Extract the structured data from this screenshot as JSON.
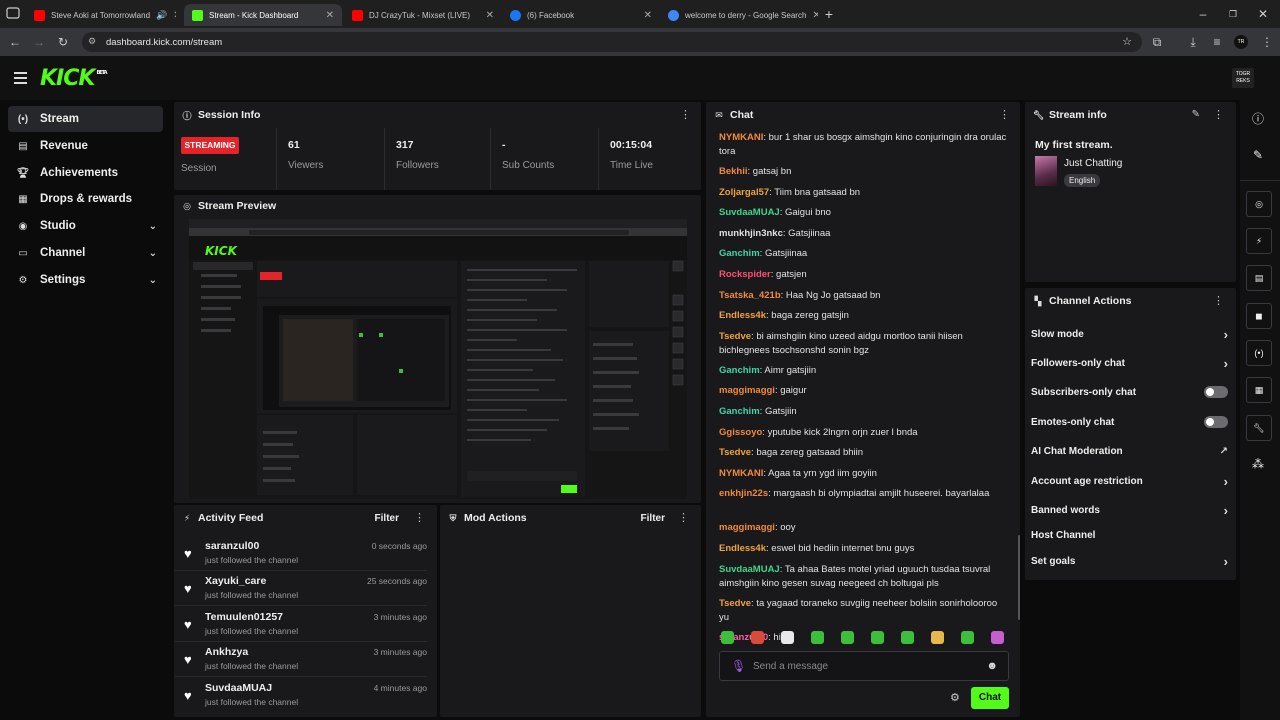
{
  "browser": {
    "tabs": [
      {
        "title": "Steve Aoki at Tomorrowland",
        "favicon_color": "#ff0000"
      },
      {
        "title": "Stream - Kick Dashboard",
        "favicon_color": "#53fc18"
      },
      {
        "title": "DJ CrazyTuk - Mixset (LIVE)",
        "favicon_color": "#ff0000"
      },
      {
        "title": "(6) Facebook",
        "favicon_color": "#1877f2"
      },
      {
        "title": "welcome to derry - Google Search",
        "favicon_color": "#4285f4"
      }
    ],
    "url": "dashboard.kick.com/stream"
  },
  "app": {
    "logo": "KICK",
    "logo_badge": "BETA",
    "avatar_text": "TOGR REKS"
  },
  "sidebar": {
    "items": [
      {
        "label": "Stream",
        "icon": "broadcast-icon"
      },
      {
        "label": "Revenue",
        "icon": "revenue-icon"
      },
      {
        "label": "Achievements",
        "icon": "trophy-icon"
      },
      {
        "label": "Drops & rewards",
        "icon": "gift-icon"
      },
      {
        "label": "Studio",
        "icon": "studio-icon"
      },
      {
        "label": "Channel",
        "icon": "channel-icon"
      },
      {
        "label": "Settings",
        "icon": "gear-icon"
      }
    ]
  },
  "session": {
    "title": "Session Info",
    "badge": "STREAMING",
    "session_label": "Session",
    "viewers": "61",
    "viewers_label": "Viewers",
    "followers": "317",
    "followers_label": "Followers",
    "subs": "-",
    "subs_label": "Sub Counts",
    "time": "00:15:04",
    "time_label": "Time Live"
  },
  "preview": {
    "title": "Stream Preview"
  },
  "activity": {
    "title": "Activity Feed",
    "filter": "Filter",
    "items": [
      {
        "name": "saranzul00",
        "sub": "just followed the channel",
        "time": "0 seconds ago"
      },
      {
        "name": "Xayuki_care",
        "sub": "just followed the channel",
        "time": "25 seconds ago"
      },
      {
        "name": "Temuulen01257",
        "sub": "just followed the channel",
        "time": "3 minutes ago"
      },
      {
        "name": "Ankhzya",
        "sub": "just followed the channel",
        "time": "3 minutes ago"
      },
      {
        "name": "SuvdaaMUAJ",
        "sub": "just followed the channel",
        "time": "4 minutes ago"
      }
    ]
  },
  "mod": {
    "title": "Mod Actions",
    "filter": "Filter"
  },
  "chat": {
    "title": "Chat",
    "messages": [
      {
        "user": "NYMKANI",
        "color": "#f08a3c",
        "text": "bur 1 shar us bosgx aimshgin kino conjuringin dra orulac tora"
      },
      {
        "user": "Bekhii",
        "color": "#f08a3c",
        "text": "gatsaj bn"
      },
      {
        "user": "Zoljargal57",
        "color": "#f0a23c",
        "text": "Tiim bna gatsaad bn"
      },
      {
        "user": "SuvdaaMUAJ",
        "color": "#3dd68c",
        "text": "Gaigui bno"
      },
      {
        "user": "munkhjin3nkc",
        "color": "#e0e0e0",
        "text": "Gatsjiinaa"
      },
      {
        "user": "Ganchim",
        "color": "#3dd6a8",
        "text": "Gatsjiinaa"
      },
      {
        "user": "Rockspider",
        "color": "#ff4f6d",
        "text": "gatsjen"
      },
      {
        "user": "Tsatska_421b",
        "color": "#f08a3c",
        "text": "Haa Ng Jo gatsaad bn"
      },
      {
        "user": "Endless4k",
        "color": "#f0a23c",
        "text": "baga zereg gatsjin"
      },
      {
        "user": "Tsedve",
        "color": "#f0a23c",
        "text": "bi aimshgiin kino uzeed aidgu mortloo tanii hiisen bichlegnees tsochsonshd sonin bgz"
      },
      {
        "user": "Ganchim",
        "color": "#3dd6a8",
        "text": "Aimr gatsjiin"
      },
      {
        "user": "maggimaggi",
        "color": "#f08a3c",
        "text": "gaigur"
      },
      {
        "user": "Ganchim",
        "color": "#3dd6a8",
        "text": "Gatsjiin"
      },
      {
        "user": "Ggissoyo",
        "color": "#f08a3c",
        "text": "yputube kick 2lngrn orjn zuer l bnda"
      },
      {
        "user": "Tsedve",
        "color": "#f0a23c",
        "text": "baga zereg gatsaad bhiin"
      },
      {
        "user": "NYMKANI",
        "color": "#f08a3c",
        "text": "Agaa ta yrn ygd iim goyiin"
      },
      {
        "user": "enkhjin22s",
        "color": "#f08a3c",
        "text": "margaash bi olympiadtai amjilt huseerei. bayarlalaa"
      },
      {
        "user": "maggimaggi",
        "color": "#f08a3c",
        "text": "ooy"
      },
      {
        "user": "Endless4k",
        "color": "#f0a23c",
        "text": "eswel bid hediin internet bnu guys"
      },
      {
        "user": "SuvdaaMUAJ",
        "color": "#3dd68c",
        "text": "Ta ahaa Bates motel yriad uguuch tusdaa tsuvral aimshgiin kino gesen suvag neegeed ch boltugai pls"
      },
      {
        "user": "Tsedve",
        "color": "#f0a23c",
        "text": "ta yagaad toraneko suvgiig neeheer bolsiin sonirholooroo yu"
      },
      {
        "user": "saranzul00",
        "color": "#ff5fa8",
        "text": "hiii"
      }
    ],
    "placeholder": "Send a message",
    "send_label": "Chat"
  },
  "stream_info": {
    "title": "Stream info",
    "stream_title": "My first stream.",
    "category": "Just Chatting",
    "language": "English"
  },
  "channel_actions": {
    "title": "Channel Actions",
    "items": [
      {
        "label": "Slow mode",
        "control": "chevron"
      },
      {
        "label": "Followers-only chat",
        "control": "chevron"
      },
      {
        "label": "Subscribers-only chat",
        "control": "toggle"
      },
      {
        "label": "Emotes-only chat",
        "control": "toggle"
      },
      {
        "label": "AI Chat Moderation",
        "control": "external"
      },
      {
        "label": "Account age restriction",
        "control": "chevron"
      },
      {
        "label": "Banned words",
        "control": "chevron"
      },
      {
        "label": "Host Channel",
        "control": "none"
      },
      {
        "label": "Set goals",
        "control": "chevron"
      }
    ]
  },
  "colors": {
    "brand": "#53fc18",
    "streaming": "#e3242b",
    "panel": "#19191b"
  }
}
